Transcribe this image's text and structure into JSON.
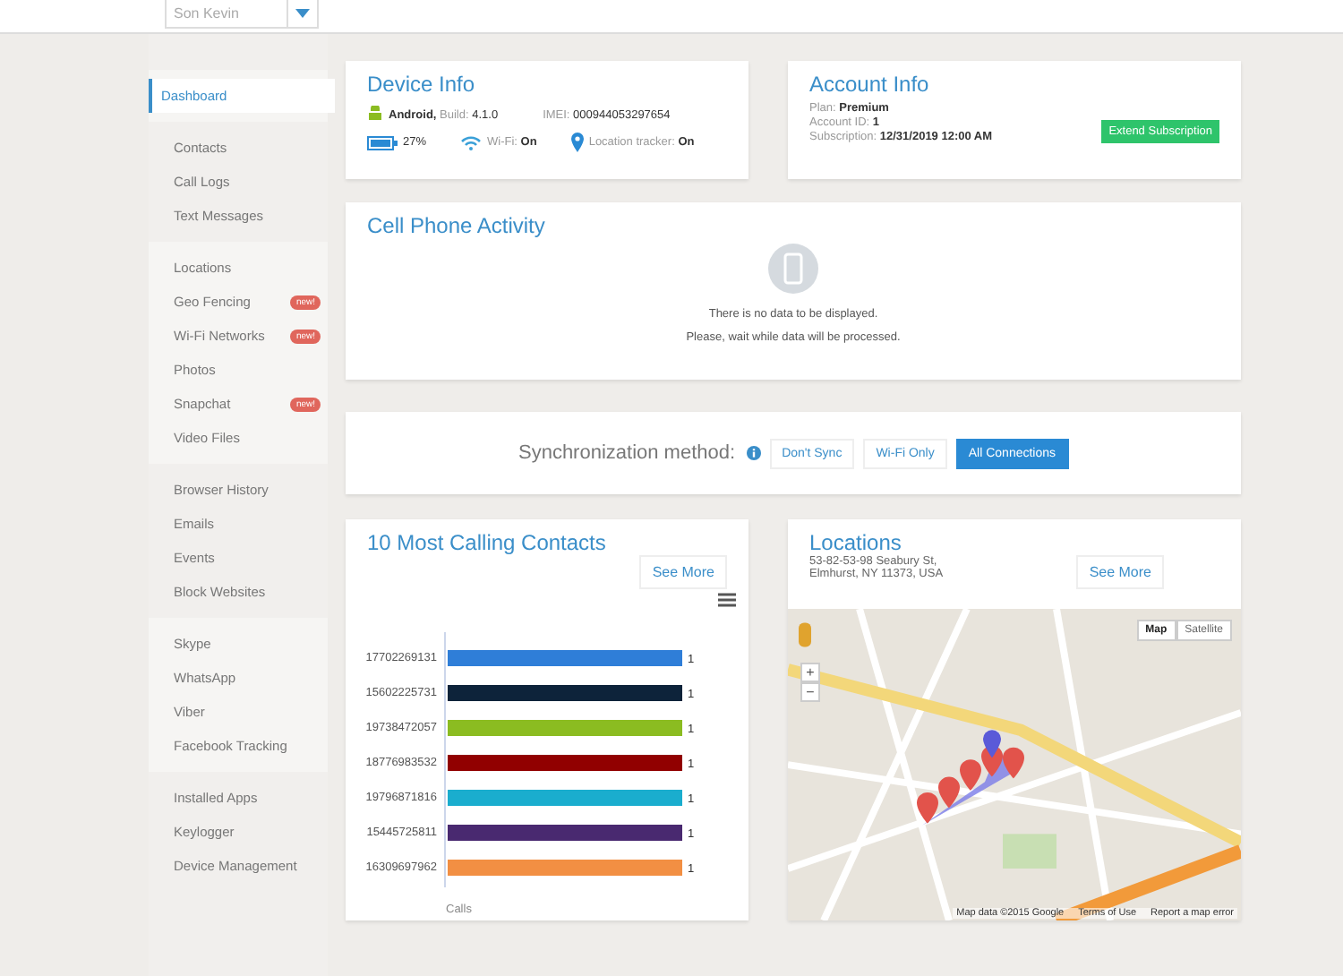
{
  "account_select": {
    "value": "Son Kevin"
  },
  "sidebar": {
    "groups": [
      {
        "items": [
          {
            "label": "Dashboard",
            "selected": true
          }
        ]
      },
      {
        "items": [
          {
            "label": "Contacts",
            "selected": false
          },
          {
            "label": "Call Logs",
            "selected": false
          },
          {
            "label": "Text Messages",
            "selected": false
          }
        ]
      },
      {
        "items": [
          {
            "label": "Locations",
            "selected": false
          },
          {
            "label": "Geo Fencing",
            "selected": false,
            "badge": "new!"
          },
          {
            "label": "Wi-Fi Networks",
            "selected": false,
            "badge": "new!"
          },
          {
            "label": "Photos",
            "selected": false
          },
          {
            "label": "Snapchat",
            "selected": false,
            "badge": "new!"
          },
          {
            "label": "Video Files",
            "selected": false
          }
        ]
      },
      {
        "items": [
          {
            "label": "Browser History",
            "selected": false
          },
          {
            "label": "Emails",
            "selected": false
          },
          {
            "label": "Events",
            "selected": false
          },
          {
            "label": "Block Websites",
            "selected": false
          }
        ]
      },
      {
        "items": [
          {
            "label": "Skype",
            "selected": false
          },
          {
            "label": "WhatsApp",
            "selected": false
          },
          {
            "label": "Viber",
            "selected": false
          },
          {
            "label": "Facebook Tracking",
            "selected": false
          }
        ]
      },
      {
        "items": [
          {
            "label": "Installed Apps",
            "selected": false
          },
          {
            "label": "Keylogger",
            "selected": false
          },
          {
            "label": "Device Management",
            "selected": false
          }
        ]
      }
    ]
  },
  "device_info": {
    "title": "Device Info",
    "os": "Android,",
    "build_label": "Build:",
    "build": "4.1.0",
    "imei_label": "IMEI:",
    "imei": "000944053297654",
    "battery": "27%",
    "wifi_label": "Wi-Fi:",
    "wifi": "On",
    "tracker_label": "Location tracker:",
    "tracker": "On"
  },
  "account_info": {
    "title": "Account Info",
    "fields": [
      {
        "label": "Plan:",
        "value": "Premium"
      },
      {
        "label": "Account ID:",
        "value": "1"
      },
      {
        "label": "Subscription:",
        "value": "12/31/2019 12:00 AM"
      }
    ],
    "button": "Extend Subscription"
  },
  "activity": {
    "title": "Cell Phone Activity",
    "messages": [
      "There is no data to be displayed.",
      "Please, wait while data will be processed."
    ]
  },
  "sync": {
    "label": "Synchronization method:",
    "options": [
      {
        "label": "Don't Sync",
        "selected": false
      },
      {
        "label": "Wi-Fi Only",
        "selected": false
      },
      {
        "label": "All Connections",
        "selected": true
      }
    ]
  },
  "contacts_chart": {
    "title": "10 Most Calling Contacts",
    "button": "See More",
    "chart_data": {
      "type": "bar",
      "orientation": "horizontal",
      "xlabel": "Calls",
      "categories": [
        "17702269131",
        "15602225731",
        "19738472057",
        "18776983532",
        "19796871816",
        "15445725811",
        "16309697962"
      ],
      "values": [
        1,
        1,
        1,
        1,
        1,
        1,
        1
      ],
      "colors": [
        "#2f7ed8",
        "#0d233a",
        "#8bbc21",
        "#910000",
        "#1aadce",
        "#492970",
        "#f28f43"
      ],
      "data_labels": true
    }
  },
  "locations": {
    "title": "Locations",
    "address": [
      "53-82-53-98 Seabury St,",
      "Elmhurst, NY 11373, USA"
    ],
    "button": "See More",
    "map_types": [
      {
        "label": "Map",
        "selected": true
      },
      {
        "label": "Satellite",
        "selected": false
      }
    ],
    "zoom_in": "+",
    "zoom_out": "−",
    "attribution": "Map data ©2015 Google",
    "terms": "Terms of Use",
    "report": "Report a map error"
  }
}
